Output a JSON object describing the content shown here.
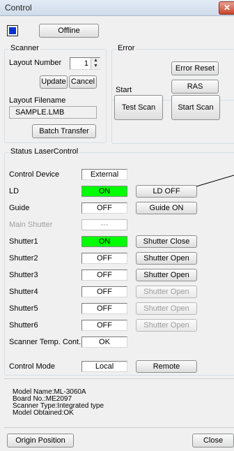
{
  "window": {
    "title": "Control",
    "close_glyph": "✕"
  },
  "top": {
    "indicator_color": "#0033cc",
    "offline_label": "Offline"
  },
  "scanner": {
    "legend": "Scanner",
    "layout_number_label": "Layout Number",
    "layout_number_value": "1",
    "update_label": "Update",
    "cancel_label": "Cancel",
    "layout_filename_label": "Layout Filename",
    "layout_filename_value": "SAMPLE.LMB",
    "batch_transfer_label": "Batch Transfer"
  },
  "error": {
    "legend": "Error",
    "reset_label": "Error Reset",
    "ras_label": "RAS"
  },
  "start": {
    "legend": "Start",
    "test_scan_label": "Test Scan",
    "start_scan_label": "Start Scan"
  },
  "status": {
    "legend": "Status LaserControl",
    "rows": [
      {
        "label": "Control Device",
        "value": "External",
        "state": "normal",
        "button": null
      },
      {
        "label": "LD",
        "value": "ON",
        "state": "green",
        "button": "LD OFF",
        "button_enabled": true
      },
      {
        "label": "Guide",
        "value": "OFF",
        "state": "normal",
        "button": "Guide ON",
        "button_enabled": true
      },
      {
        "label": "Main Shutter",
        "value": "---",
        "state": "disabled",
        "button": null
      },
      {
        "label": "Shutter1",
        "value": "ON",
        "state": "green",
        "button": "Shutter Close",
        "button_enabled": true
      },
      {
        "label": "Shutter2",
        "value": "OFF",
        "state": "normal",
        "button": "Shutter Open",
        "button_enabled": true
      },
      {
        "label": "Shutter3",
        "value": "OFF",
        "state": "normal",
        "button": "Shutter Open",
        "button_enabled": true
      },
      {
        "label": "Shutter4",
        "value": "OFF",
        "state": "normal",
        "button": "Shutter Open",
        "button_enabled": false
      },
      {
        "label": "Shutter5",
        "value": "OFF",
        "state": "normal",
        "button": "Shutter Open",
        "button_enabled": false
      },
      {
        "label": "Shutter6",
        "value": "OFF",
        "state": "normal",
        "button": "Shutter Open",
        "button_enabled": false
      },
      {
        "label": "Scanner Temp. Cont.",
        "value": "OK",
        "state": "normal",
        "button": null
      },
      {
        "label": "Control Mode",
        "value": "Local",
        "state": "normal",
        "button": "Remote",
        "button_enabled": true
      }
    ]
  },
  "info": {
    "model_name": "Model Name:ML-3060A",
    "board_no": "Board No.:ME2097",
    "scanner_type": "Scanner Type:Integrated type",
    "model_obtained": "Model Obtained:OK"
  },
  "footer": {
    "origin_position_label": "Origin Position",
    "close_label": "Close"
  }
}
